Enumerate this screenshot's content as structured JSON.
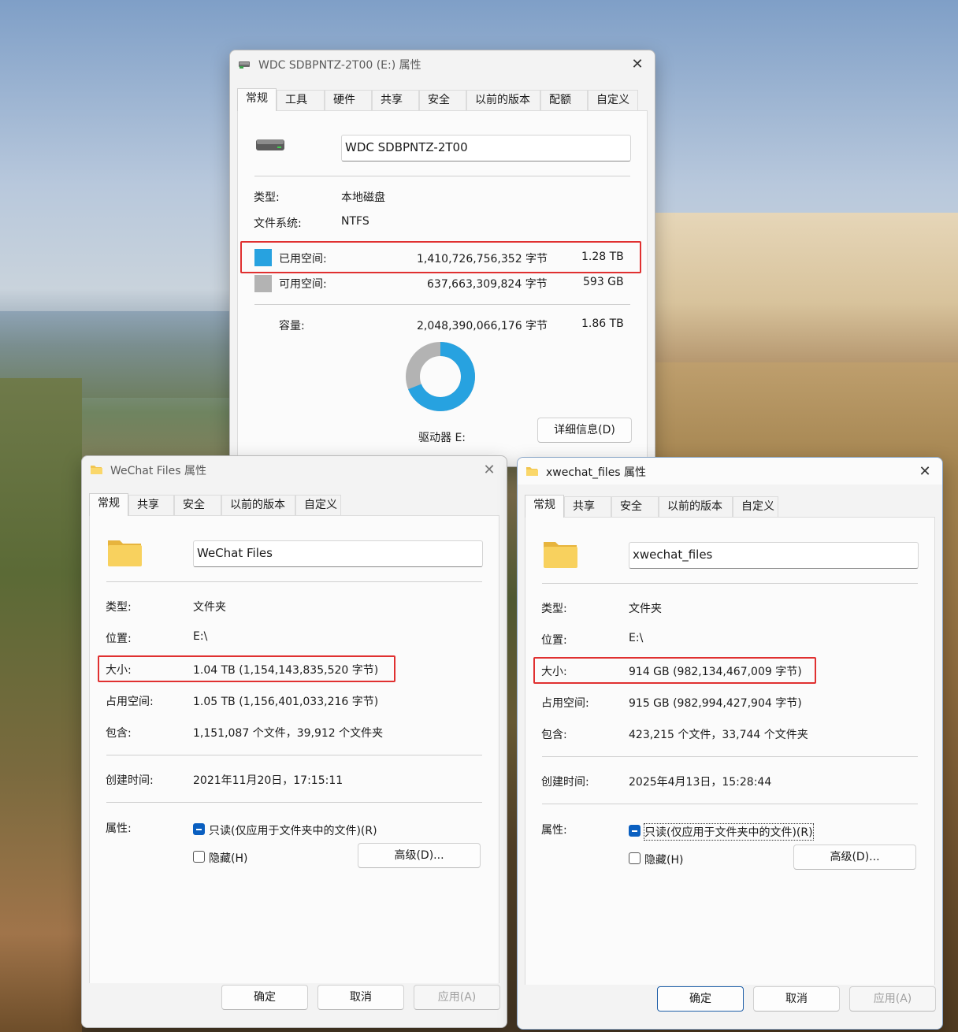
{
  "colors": {
    "used": "#27a2e0",
    "free": "#b3b3b3",
    "highlight": "#e03030",
    "checkbox": "#0a5fc0"
  },
  "drive_window": {
    "title": "WDC SDBPNTZ-2T00 (E:) 属性",
    "tabs": [
      "常规",
      "工具",
      "硬件",
      "共享",
      "安全",
      "以前的版本",
      "配额",
      "自定义"
    ],
    "name": "WDC SDBPNTZ-2T00",
    "type_label": "类型:",
    "type_value": "本地磁盘",
    "fs_label": "文件系统:",
    "fs_value": "NTFS",
    "used_label": "已用空间:",
    "used_bytes": "1,410,726,756,352 字节",
    "used_size": "1.28 TB",
    "free_label": "可用空间:",
    "free_bytes": "637,663,309,824 字节",
    "free_size": "593 GB",
    "cap_label": "容量:",
    "cap_bytes": "2,048,390,066,176 字节",
    "cap_size": "1.86 TB",
    "used_fraction": 0.689,
    "drive_label": "驱动器 E:",
    "details_button": "详细信息(D)"
  },
  "wechat_window": {
    "title": "WeChat Files 属性",
    "tabs": [
      "常规",
      "共享",
      "安全",
      "以前的版本",
      "自定义"
    ],
    "name": "WeChat Files",
    "type_label": "类型:",
    "type_value": "文件夹",
    "location_label": "位置:",
    "location_value": "E:\\",
    "size_label": "大小:",
    "size_value": "1.04 TB (1,154,143,835,520 字节)",
    "ondisk_label": "占用空间:",
    "ondisk_value": "1.05 TB (1,156,401,033,216 字节)",
    "contains_label": "包含:",
    "contains_value": "1,151,087 个文件，39,912 个文件夹",
    "created_label": "创建时间:",
    "created_value": "2021年11月20日，17:15:11",
    "attr_label": "属性:",
    "readonly_label": "只读(仅应用于文件夹中的文件)(R)",
    "hidden_label": "隐藏(H)",
    "advanced_button": "高级(D)...",
    "ok_button": "确定",
    "cancel_button": "取消",
    "apply_button": "应用(A)"
  },
  "xwechat_window": {
    "title": "xwechat_files 属性",
    "tabs": [
      "常规",
      "共享",
      "安全",
      "以前的版本",
      "自定义"
    ],
    "name": "xwechat_files",
    "type_label": "类型:",
    "type_value": "文件夹",
    "location_label": "位置:",
    "location_value": "E:\\",
    "size_label": "大小:",
    "size_value": "914 GB (982,134,467,009 字节)",
    "ondisk_label": "占用空间:",
    "ondisk_value": "915 GB (982,994,427,904 字节)",
    "contains_label": "包含:",
    "contains_value": "423,215 个文件，33,744 个文件夹",
    "created_label": "创建时间:",
    "created_value": "2025年4月13日，15:28:44",
    "attr_label": "属性:",
    "readonly_label": "只读(仅应用于文件夹中的文件)(R)",
    "hidden_label": "隐藏(H)",
    "advanced_button": "高级(D)...",
    "ok_button": "确定",
    "cancel_button": "取消",
    "apply_button": "应用(A)"
  }
}
